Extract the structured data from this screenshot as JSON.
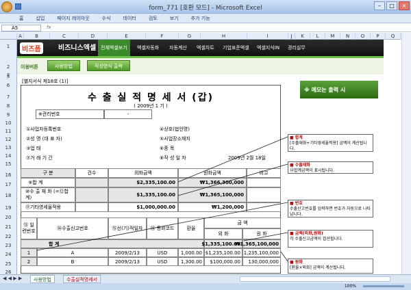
{
  "window": {
    "title": "form_771 [호환 모드] - Microsoft Excel"
  },
  "ribbon_tabs": [
    "홈",
    "삽입",
    "페이지 레이아웃",
    "수식",
    "데이터",
    "검토",
    "보기",
    "추가 기능"
  ],
  "namebox": "A5",
  "fx": "fx",
  "columns": [
    "A",
    "B",
    "C",
    "D",
    "E",
    "F",
    "G",
    "H",
    "I",
    "J",
    "K",
    "L",
    "M",
    "N",
    "O",
    "P",
    "Q"
  ],
  "rows": [
    "1",
    "2",
    "3",
    "4",
    "5",
    "6",
    "7",
    "8",
    "9",
    "10",
    "11",
    "12",
    "13",
    "14",
    "15",
    "16",
    "17",
    "18",
    "19",
    "20",
    "21",
    "22",
    "23",
    "24",
    "25",
    "26"
  ],
  "nav": {
    "logo_main": "비즈폼",
    "logo_sub": "비즈니스엑셀",
    "items": [
      "전체엑셀보기",
      "엑셀자동화",
      "자동계산",
      "엑셀차트",
      "기업표준엑셀",
      "엑셀지식IN",
      "경리실무"
    ]
  },
  "toolbar": {
    "label": "이용버튼",
    "btn_usage": "사용방법",
    "btn_print": "작성양식 출력"
  },
  "memo": "※ 메모는 출력 시",
  "form": {
    "form_no": "[별지서식 제18호 (1)]",
    "title": "수 출 실 적 명 세 서 (갑)",
    "year": "( 2009년 1 기 )",
    "mgmt_label": "※관리번호",
    "mgmt_value": "-",
    "left_labels": [
      "①사업자등록번호",
      "②성 명 (대 표 자)",
      "③업 태",
      "⑦거 래 기 간"
    ],
    "right_labels": [
      "④상호(법인명)",
      "⑤사업장소재지",
      "⑥종 목",
      "⑧작 성 일 자"
    ],
    "date_value": "2009년 2월 18일",
    "head_cols": [
      "구 분",
      "건수",
      "외화금액",
      "원화금액",
      "비고"
    ],
    "sum_rows": [
      {
        "label": "⑨합 계",
        "fx": "$2,335,100.00",
        "won": "₩1,366,300,000"
      },
      {
        "label": "⑩수 출 재 화 (=⑫합계)",
        "fx": "$1,335,100.00",
        "won": "₩1,365,100,000"
      },
      {
        "label": "⑪기타영세율적용",
        "fx": "$1,000,000.00",
        "won": "₩1,200,000"
      }
    ],
    "detail_head": {
      "seq": "⑬ 일련번호",
      "decl": "⑭수출신고번호",
      "date": "⑮선(기)적일자",
      "cur": "⑯ 통화코드",
      "rate": "환율",
      "amount": "금 액",
      "fx": "외 화",
      "won": "원 화"
    },
    "total_label": "합 계",
    "total_fx": "$1,335,100.00",
    "total_won": "₩1,365,100,000",
    "rows": [
      {
        "seq": "1",
        "decl": "A",
        "date": "2009/2/13",
        "cur": "USD",
        "rate": "1,000.00",
        "fx": "$1,235,100.00",
        "won": "1,235,100,000"
      },
      {
        "seq": "2",
        "decl": "B",
        "date": "2009/2/13",
        "cur": "USD",
        "rate": "1,300.00",
        "fx": "$100,000.00",
        "won": "130,000,000"
      }
    ]
  },
  "notes": [
    {
      "title": "합계",
      "body": "[수출재화+기타영세율적용] 금액이 계산됩니다."
    },
    {
      "title": "수출재화",
      "body": "⑫합계금액이 표시됩니다."
    },
    {
      "title": "번호",
      "body": "수출신고번호를 입력하면 번호가 자동으로 나타납니다."
    },
    {
      "title": "금액(외화,원화)",
      "body": "각 수출신고금액이 합산됩니다."
    },
    {
      "title": "원화",
      "body": "[환율×외화] 금액이 계산됩니다."
    }
  ],
  "sheets": [
    "사용방법",
    "수출실적명세서"
  ],
  "status": {
    "zoom": "100%"
  }
}
